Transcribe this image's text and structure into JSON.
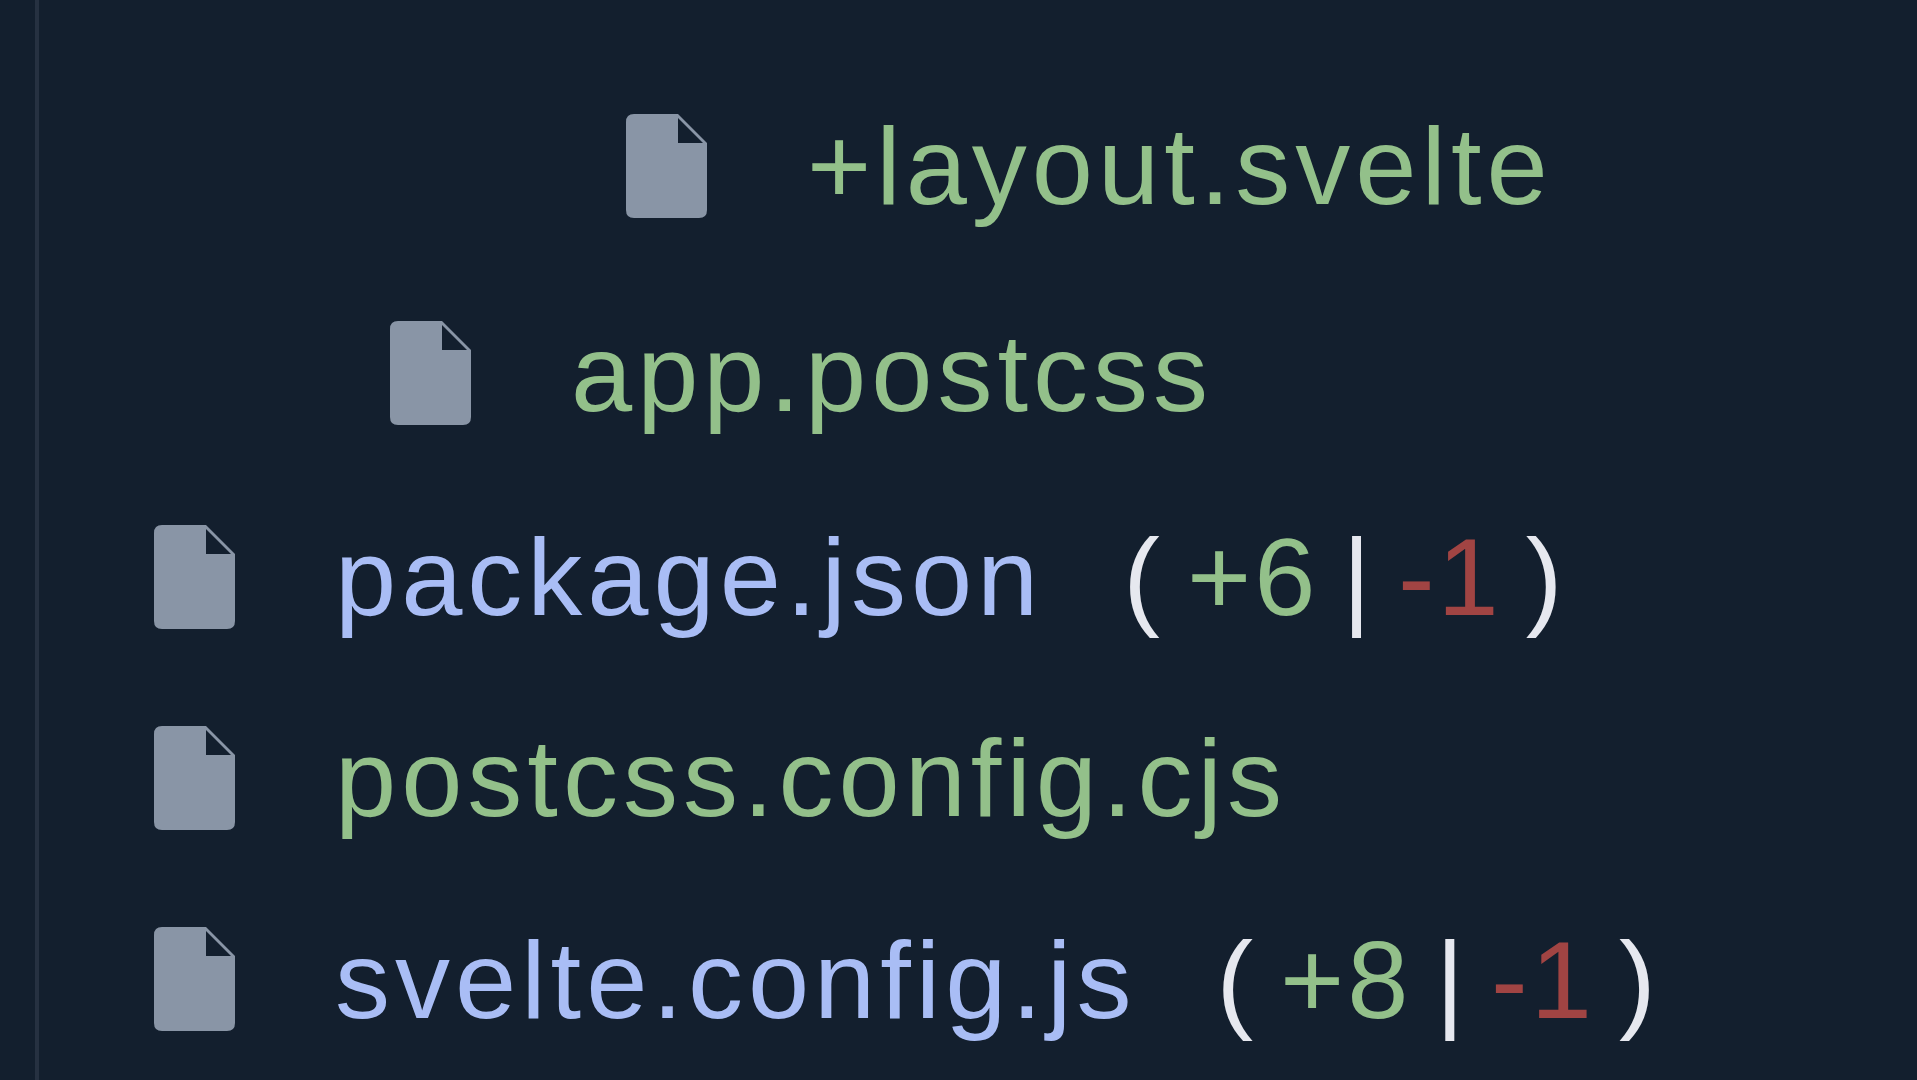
{
  "file_tree": [
    {
      "children": [
        {
          "children": [
            {
              "name": "+layout.svelte",
              "kind": "added"
            }
          ]
        },
        {
          "name": "app.postcss",
          "kind": "added"
        }
      ]
    },
    {
      "name": "package.json",
      "kind": "modified",
      "diff": {
        "open": "(",
        "added": "+6",
        "separator": "|",
        "removed": "-1",
        "close": ")"
      }
    },
    {
      "name": "postcss.config.cjs",
      "kind": "added"
    },
    {
      "name": "svelte.config.js",
      "kind": "modified",
      "diff": {
        "open": "(",
        "added": "+8",
        "separator": "|",
        "removed": "-1",
        "close": ")"
      }
    }
  ]
}
